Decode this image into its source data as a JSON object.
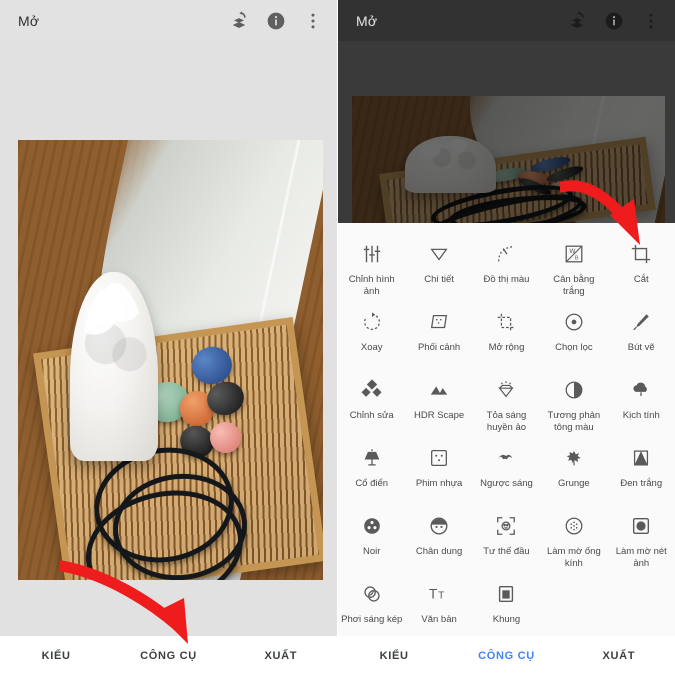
{
  "app": {
    "title": "Mở",
    "header_icons": [
      "undo-stack-icon",
      "info-icon",
      "overflow-menu-icon"
    ]
  },
  "left_panel": {
    "header_title": "Mở",
    "canvas_bg": "#e1e1e1",
    "photo_description": "Wooden table with bamboo tray, white sculpture bust, colored gemstones and black cord",
    "bottom_nav": [
      {
        "label": "KIỂU",
        "active": false
      },
      {
        "label": "CÔNG CỤ",
        "active": false
      },
      {
        "label": "XUẤT",
        "active": false
      }
    ]
  },
  "right_panel": {
    "header_title": "Mở",
    "canvas_bg": "#3a3a3a",
    "bottom_nav": [
      {
        "label": "KIỂU",
        "active": false
      },
      {
        "label": "CÔNG CỤ",
        "active": true
      },
      {
        "label": "XUẤT",
        "active": false
      }
    ],
    "tools": [
      [
        {
          "label": "Chỉnh hình ảnh",
          "icon": "tune-sliders-icon"
        },
        {
          "label": "Chi tiết",
          "icon": "triangle-detail-icon"
        },
        {
          "label": "Đồ thị màu",
          "icon": "curves-icon"
        },
        {
          "label": "Cân bằng trắng",
          "icon": "white-balance-icon"
        },
        {
          "label": "Cắt",
          "icon": "crop-icon"
        }
      ],
      [
        {
          "label": "Xoay",
          "icon": "rotate-icon"
        },
        {
          "label": "Phối cảnh",
          "icon": "perspective-icon"
        },
        {
          "label": "Mở rộng",
          "icon": "expand-icon"
        },
        {
          "label": "Chọn lọc",
          "icon": "selective-icon"
        },
        {
          "label": "Bút vẽ",
          "icon": "brush-icon"
        }
      ],
      [
        {
          "label": "Chỉnh sửa",
          "icon": "healing-icon"
        },
        {
          "label": "HDR Scape",
          "icon": "mountains-icon"
        },
        {
          "label": "Tỏa sáng huyền ảo",
          "icon": "glamour-glow-icon"
        },
        {
          "label": "Tương phản tông màu",
          "icon": "tonal-contrast-icon"
        },
        {
          "label": "Kịch tính",
          "icon": "drama-cloud-icon"
        }
      ],
      [
        {
          "label": "Cổ điển",
          "icon": "vintage-lamp-icon"
        },
        {
          "label": "Phim nhựa",
          "icon": "grainy-film-icon"
        },
        {
          "label": "Ngược sáng",
          "icon": "retrolux-icon"
        },
        {
          "label": "Grunge",
          "icon": "grunge-icon"
        },
        {
          "label": "Đen trắng",
          "icon": "black-white-icon"
        }
      ],
      [
        {
          "label": "Noir",
          "icon": "film-reel-icon"
        },
        {
          "label": "Chân dung",
          "icon": "portrait-face-icon"
        },
        {
          "label": "Tư thế đầu",
          "icon": "head-pose-icon"
        },
        {
          "label": "Làm mờ ống kính",
          "icon": "lens-blur-icon"
        },
        {
          "label": "Làm mờ nét ảnh",
          "icon": "vignette-icon"
        }
      ],
      [
        {
          "label": "Phơi sáng kép",
          "icon": "double-exposure-icon"
        },
        {
          "label": "Văn bản",
          "icon": "text-icon"
        },
        {
          "label": "Khung",
          "icon": "frames-icon"
        }
      ]
    ]
  },
  "annotations": {
    "arrow_color": "#ee1c1c",
    "left_arrow_target": "CÔNG CỤ",
    "right_arrow_target": "Cắt"
  }
}
